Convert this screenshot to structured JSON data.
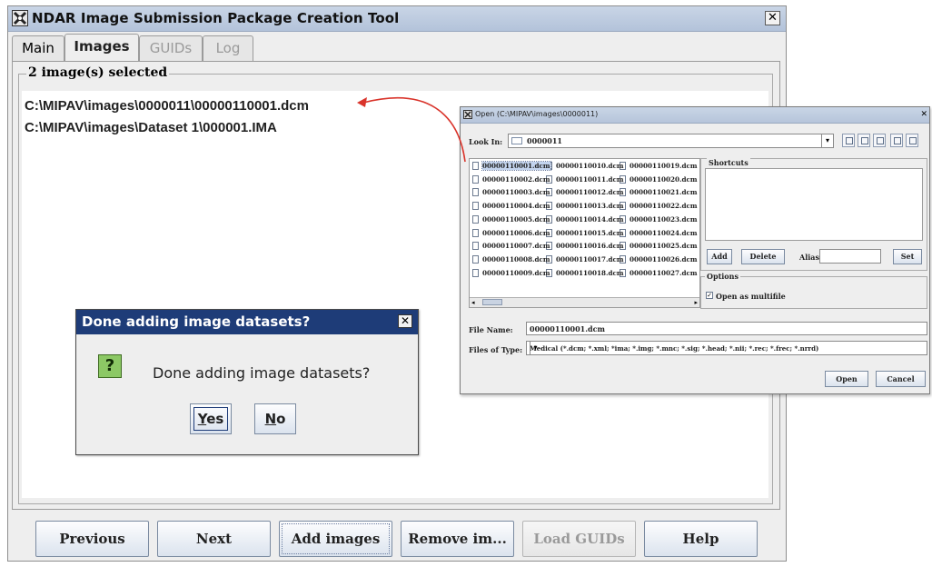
{
  "window": {
    "title": "NDAR Image Submission Package Creation Tool",
    "close_glyph": "✕"
  },
  "tabs": [
    {
      "label": "Main",
      "state": "normal"
    },
    {
      "label": "Images",
      "state": "active"
    },
    {
      "label": "GUIDs",
      "state": "disabled"
    },
    {
      "label": "Log",
      "state": "disabled"
    }
  ],
  "images_panel": {
    "group_title": "2 image(s) selected",
    "items": [
      "C:\\MIPAV\\images\\0000011\\00000110001.dcm",
      "C:\\MIPAV\\images\\Dataset 1\\000001.IMA"
    ]
  },
  "bottom_buttons": [
    {
      "label": "Previous",
      "enabled": true
    },
    {
      "label": "Next",
      "enabled": true
    },
    {
      "label": "Add images",
      "enabled": true
    },
    {
      "label": "Remove im...",
      "enabled": true
    },
    {
      "label": "Load GUIDs",
      "enabled": false
    },
    {
      "label": "Help",
      "enabled": true
    }
  ],
  "confirm_dialog": {
    "title": "Done adding image datasets?",
    "message": "Done adding image datasets?",
    "icon": "question-icon",
    "icon_glyph": "?",
    "yes_mnemonic": "Y",
    "yes_rest": "es",
    "no_mnemonic": "N",
    "no_rest": "o"
  },
  "file_chooser": {
    "title": "Open (C:\\MIPAV\\images\\0000011)",
    "look_in_label": "Look In:",
    "look_in_value": "0000011",
    "files": [
      "00000110001.dcm",
      "00000110002.dcm",
      "00000110003.dcm",
      "00000110004.dcm",
      "00000110005.dcm",
      "00000110006.dcm",
      "00000110007.dcm",
      "00000110008.dcm",
      "00000110009.dcm",
      "00000110010.dcm",
      "00000110011.dcm",
      "00000110012.dcm",
      "00000110013.dcm",
      "00000110014.dcm",
      "00000110015.dcm",
      "00000110016.dcm",
      "00000110017.dcm",
      "00000110018.dcm",
      "00000110019.dcm",
      "00000110020.dcm",
      "00000110021.dcm",
      "00000110022.dcm",
      "00000110023.dcm",
      "00000110024.dcm",
      "00000110025.dcm",
      "00000110026.dcm",
      "00000110027.dcm"
    ],
    "selected_file": "00000110001.dcm",
    "shortcuts_label": "Shortcuts",
    "add_label": "Add",
    "delete_label": "Delete",
    "alias_label": "Alias:",
    "set_label": "Set",
    "options_label": "Options",
    "multifile_label": "Open as multifile",
    "multifile_checked": true,
    "file_name_label": "File Name:",
    "file_name_value": "00000110001.dcm",
    "files_of_type_label": "Files of Type:",
    "files_of_type_value": "Medical (*.dcm; *.xml; *ima; *.img; *.mnc; *.sig; *.head; *.nii; *.rec; *.frec; *.nrrd)",
    "open_label": "Open",
    "cancel_label": "Cancel"
  },
  "colors": {
    "arrow": "#d9342b",
    "dialog_title_bg": "#1e3c78",
    "question_icon_bg": "#8cc865"
  }
}
